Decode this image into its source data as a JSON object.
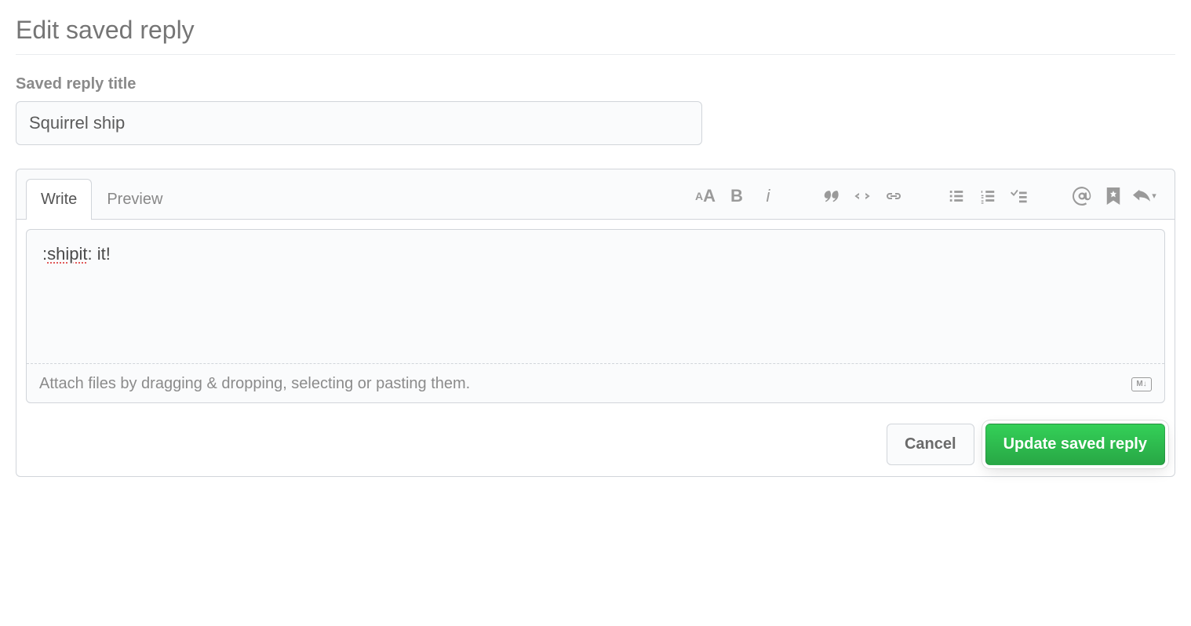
{
  "page": {
    "title": "Edit saved reply"
  },
  "field": {
    "title_label": "Saved reply title",
    "title_value": "Squirrel ship"
  },
  "tabs": {
    "write": "Write",
    "preview": "Preview",
    "active": "write"
  },
  "toolbar": {
    "heading": "aA",
    "bold": "B",
    "italic": "i",
    "reply_caret": "▾"
  },
  "body": {
    "value_prefix": ":",
    "value_spellcheck": "shipit",
    "value_suffix": ": it!"
  },
  "attach": {
    "hint": "Attach files by dragging & dropping, selecting or pasting them."
  },
  "markdown_badge": "M↓",
  "actions": {
    "cancel": "Cancel",
    "submit": "Update saved reply"
  }
}
